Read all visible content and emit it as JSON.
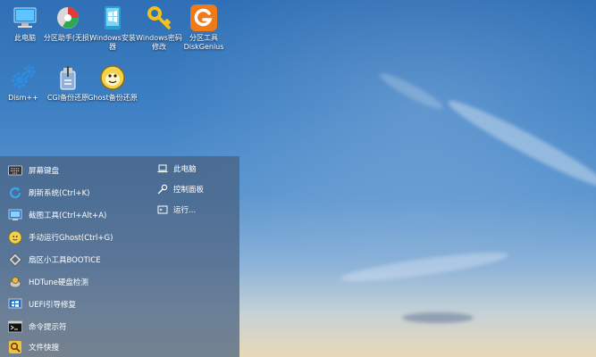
{
  "desktop_icons": [
    {
      "label": "此电脑",
      "icon": "computer-icon"
    },
    {
      "label": "分区助手(无损)",
      "icon": "partition-assistant-icon"
    },
    {
      "label": "Windows安装器",
      "icon": "windows-installer-icon"
    },
    {
      "label": "Windows密码修改",
      "icon": "key-icon"
    },
    {
      "label": "分区工具DiskGenius",
      "icon": "diskgenius-icon"
    },
    {
      "label": "Dism++",
      "icon": "gear-icon"
    },
    {
      "label": "CGI备份还原",
      "icon": "cgi-backup-icon"
    },
    {
      "label": "Ghost备份还原",
      "icon": "ghost-icon"
    }
  ],
  "start_menu": {
    "items": [
      {
        "label": "屏幕键盘",
        "icon": "keyboard-icon"
      },
      {
        "label": "刷新系统(Ctrl+K)",
        "icon": "refresh-icon"
      },
      {
        "label": "截图工具(Ctrl+Alt+A)",
        "icon": "screenshot-icon"
      },
      {
        "label": "手动运行Ghost(Ctrl+G)",
        "icon": "ghost-icon"
      },
      {
        "label": "扇区小工具BOOTICE",
        "icon": "bootice-icon"
      },
      {
        "label": "HDTune硬盘检测",
        "icon": "hdtune-icon"
      },
      {
        "label": "UEFI引导修复",
        "icon": "uefi-icon"
      },
      {
        "label": "命令提示符",
        "icon": "terminal-icon"
      },
      {
        "label": "文件快搜",
        "icon": "search-icon"
      }
    ],
    "side_items": [
      {
        "label": "此电脑",
        "icon": "laptop-icon"
      },
      {
        "label": "控制面板",
        "icon": "wrench-icon"
      },
      {
        "label": "运行...",
        "icon": "run-icon"
      }
    ]
  }
}
